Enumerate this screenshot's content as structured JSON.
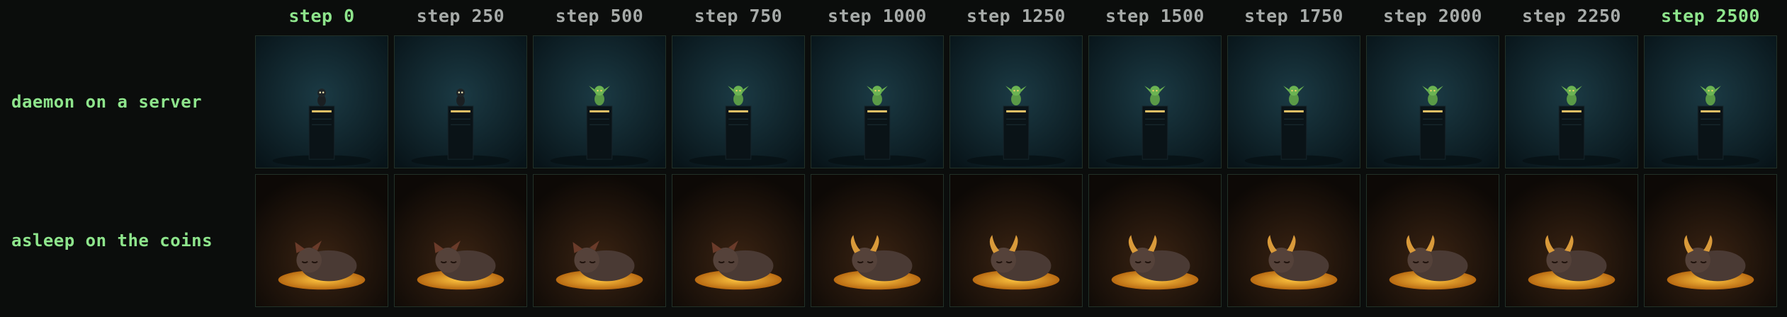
{
  "steps": [
    "step 0",
    "step 250",
    "step 500",
    "step 750",
    "step 1000",
    "step 1250",
    "step 1500",
    "step 1750",
    "step 2000",
    "step 2250",
    "step 2500"
  ],
  "highlighted_steps": [
    0,
    10
  ],
  "rows": [
    {
      "label": "daemon on a server",
      "thumbnails": [
        {
          "subject": "dark imp on server tower",
          "theme": "teal"
        },
        {
          "subject": "dark imp on server tower",
          "theme": "teal"
        },
        {
          "subject": "green goblin on server tower",
          "theme": "teal"
        },
        {
          "subject": "green goblin on server tower",
          "theme": "teal"
        },
        {
          "subject": "green goblin on server tower",
          "theme": "teal"
        },
        {
          "subject": "green goblin on server tower",
          "theme": "teal"
        },
        {
          "subject": "green goblin on server tower",
          "theme": "teal"
        },
        {
          "subject": "green goblin on server tower",
          "theme": "teal"
        },
        {
          "subject": "green goblin on server tower",
          "theme": "teal"
        },
        {
          "subject": "green goblin on server tower",
          "theme": "teal"
        },
        {
          "subject": "green goblin on server tower",
          "theme": "teal"
        }
      ]
    },
    {
      "label": "asleep on the coins",
      "thumbnails": [
        {
          "subject": "sleeping creature on gold coins",
          "theme": "amber"
        },
        {
          "subject": "sleeping creature on gold coins",
          "theme": "amber"
        },
        {
          "subject": "sleeping creature on gold coins",
          "theme": "amber"
        },
        {
          "subject": "sleeping creature on gold coins",
          "theme": "amber"
        },
        {
          "subject": "horned creature on gold coins",
          "theme": "amber"
        },
        {
          "subject": "horned creature on gold coins",
          "theme": "amber"
        },
        {
          "subject": "horned creature on gold coins",
          "theme": "amber"
        },
        {
          "subject": "horned creature on gold coins",
          "theme": "amber"
        },
        {
          "subject": "horned creature on gold coins",
          "theme": "amber"
        },
        {
          "subject": "horned creature on gold coins",
          "theme": "amber"
        },
        {
          "subject": "horned creature on gold coins",
          "theme": "amber"
        }
      ]
    }
  ],
  "colors": {
    "background": "#0b0d0c",
    "highlight": "#8ee58c",
    "header_text": "#a7aba9",
    "cell_border": "#223128"
  }
}
